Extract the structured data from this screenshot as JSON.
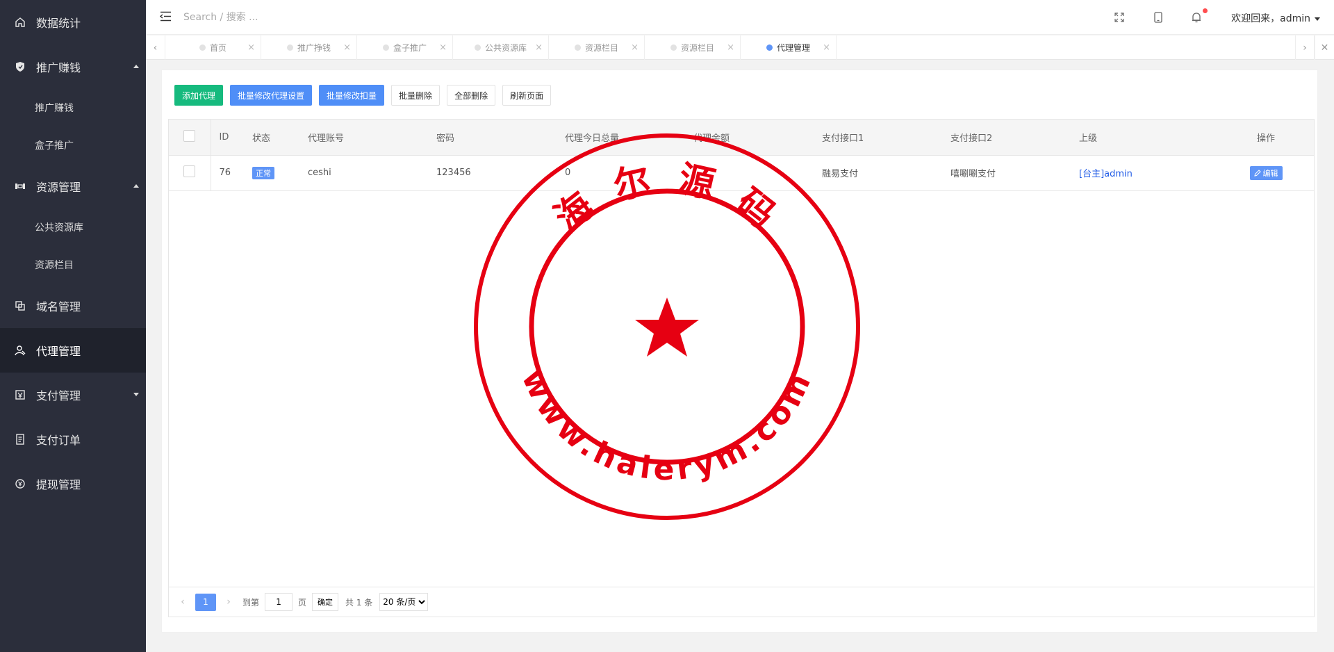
{
  "sidebar": {
    "items": [
      {
        "label": "数据统计",
        "icon": "home-icon"
      },
      {
        "label": "推广赚钱",
        "icon": "shield-icon"
      },
      {
        "label": "推广赚钱"
      },
      {
        "label": "盒子推广"
      },
      {
        "label": "资源管理",
        "icon": "resource-icon"
      },
      {
        "label": "公共资源库"
      },
      {
        "label": "资源栏目"
      },
      {
        "label": "域名管理",
        "icon": "domain-icon"
      },
      {
        "label": "代理管理",
        "icon": "agent-icon"
      },
      {
        "label": "支付管理",
        "icon": "payment-icon"
      },
      {
        "label": "支付订单",
        "icon": "order-icon"
      },
      {
        "label": "提现管理",
        "icon": "withdraw-icon"
      }
    ]
  },
  "header": {
    "search_placeholder": "Search / 搜索 ...",
    "welcome": "欢迎回来，admin"
  },
  "tabs": [
    "首页",
    "推广挣钱",
    "盒子推广",
    "公共资源库",
    "资源栏目",
    "资源栏目",
    "代理管理"
  ],
  "toolbar": {
    "add": "添加代理",
    "batch_settings": "批量修改代理设置",
    "batch_deduct": "批量修改扣量",
    "batch_delete": "批量删除",
    "delete_all": "全部删除",
    "refresh": "刷新页面"
  },
  "table": {
    "headers": [
      "ID",
      "状态",
      "代理账号",
      "密码",
      "代理今日总量",
      "代理余额",
      "支付接口1",
      "支付接口2",
      "上级",
      "操作"
    ],
    "rows": [
      {
        "id": "76",
        "status": "正常",
        "account": "ceshi",
        "password": "123456",
        "today_total": "0",
        "balance": "",
        "pay1": "融易支付",
        "pay2": "嘻唰唰支付",
        "parent": "[台主]admin",
        "action": "编辑"
      }
    ]
  },
  "pager": {
    "page": "1",
    "goto_label": "到第",
    "goto_value": "1",
    "page_unit": "页",
    "confirm": "确定",
    "total": "共 1 条",
    "page_size": "20 条/页"
  },
  "watermark": {
    "top_text": "海 尔 源 码",
    "bottom_text": "www.haierym.com"
  },
  "colors": {
    "sidebar_bg": "#2b2e3b",
    "primary_blue": "#5f95f7",
    "green": "#16ba7e",
    "stamp_red": "#e60012"
  }
}
